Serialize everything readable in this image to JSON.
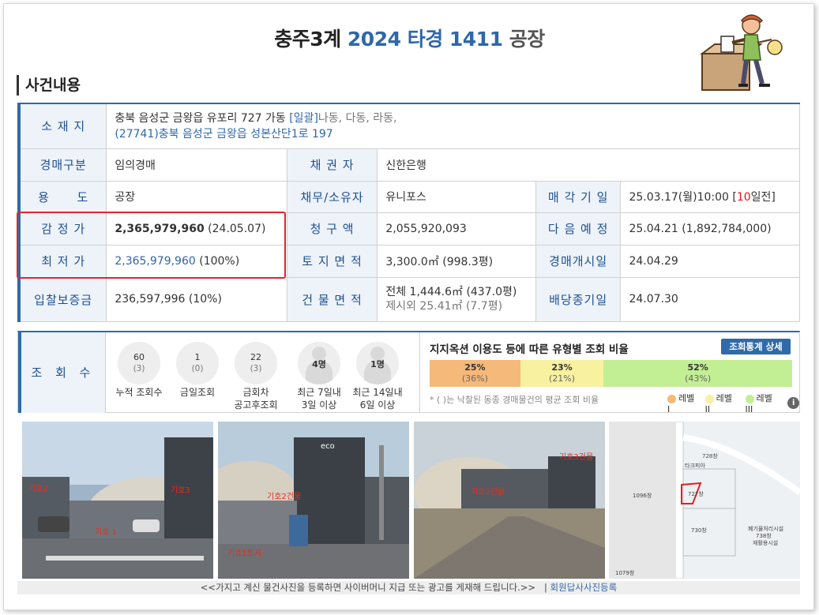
{
  "header": {
    "court": "충주3계",
    "case_no": "2024 타경 1411",
    "category": "공장"
  },
  "section_title": "사건내용",
  "info": {
    "location": {
      "label": "소 재 지",
      "line1": "충북 음성군 금왕읍 유포리 727 가동",
      "bulk": "[일괄]",
      "bulk_rest": "나동, 다동, 라동,",
      "line2": "(27741)충북 음성군  금왕읍 성본산단1로  197"
    },
    "auction_type": {
      "label": "경매구분",
      "value": "임의경매"
    },
    "creditor": {
      "label": "채 권 자",
      "value": "신한은행"
    },
    "usage": {
      "label": "용      도",
      "value": "공장"
    },
    "debtor_owner": {
      "label": "채무/소유자",
      "value": "유니포스"
    },
    "sale_date": {
      "label": "매 각 기 일",
      "value_pre": "25.03.17(월)10:00 [",
      "days": "10",
      "value_post": "일전]"
    },
    "appraisal": {
      "label": "감 정 가",
      "amount": "2,365,979,960",
      "note": "(24.05.07)"
    },
    "claim": {
      "label": "청 구 액",
      "value": "2,055,920,093"
    },
    "next_schedule": {
      "label": "다 음 예 정",
      "value": "25.04.21 (1,892,784,000)"
    },
    "minimum": {
      "label": "최 저 가",
      "amount": "2,365,979,960",
      "note": "(100%)"
    },
    "land_area": {
      "label": "토 지 면 적",
      "value": "3,300.0㎡ (998.3평)"
    },
    "auction_start": {
      "label": "경매개시일",
      "value": "24.04.29"
    },
    "deposit": {
      "label": "입찰보증금",
      "value": "236,597,996 (10%)"
    },
    "building_area": {
      "label": "건 물 면 적",
      "line1": "전체 1,444.6㎡ (437.0평)",
      "line2": "제시외 25.41㎡ (7.7평)"
    },
    "dividend_deadline": {
      "label": "배당종기일",
      "value": "24.07.30"
    }
  },
  "views": {
    "label": "조 회 수",
    "stats": [
      {
        "value": "60",
        "sub": "(3)",
        "caption1": "누적 조회수",
        "caption2": ""
      },
      {
        "value": "1",
        "sub": "(0)",
        "caption1": "금일조회",
        "caption2": ""
      },
      {
        "value": "22",
        "sub": "(3)",
        "caption1": "금회차",
        "caption2": "공고후조회"
      }
    ],
    "persons": [
      {
        "value": "4명",
        "caption1": "최근 7일내",
        "caption2": "3일 이상"
      },
      {
        "value": "1명",
        "caption1": "최근 14일내",
        "caption2": "6일 이상"
      }
    ],
    "ratio_title": "지지옥션 이용도 등에 따른 유형별 조회 비율",
    "ratio_button": "조회통계 상세",
    "ratio": [
      {
        "pct": "25%",
        "sub": "(36%)",
        "value": 25,
        "color": "#f5b97a"
      },
      {
        "pct": "23%",
        "sub": "(21%)",
        "value": 23,
        "color": "#f7f1a0"
      },
      {
        "pct": "52%",
        "sub": "(43%)",
        "value": 52,
        "color": "#c2ee94"
      }
    ],
    "note": "* ( )는 낙찰된 동종 경매물건의 평균 조회 비율",
    "legend": [
      {
        "label": "레벨 I",
        "color": "#f5b97a"
      },
      {
        "label": "레벨 II",
        "color": "#f7f1a0"
      },
      {
        "label": "레벨 III",
        "color": "#c2ee94"
      }
    ],
    "info_icon": "i"
  },
  "photos": {
    "labels": {
      "p1a": "기호2",
      "p1b": "기호3",
      "p1c": "기호 1",
      "p2a": "기호2건물",
      "p2b": "기호1토지",
      "p3a": "기호3건물",
      "p3b": "기호2건물",
      "p4_lot1": "728창",
      "p4_lot2": "727창",
      "p4_lot3": "1096창",
      "p4_lot4": "730창",
      "p4_lot5": "1079창",
      "p4_road": "타크피아",
      "p4_text1": "폐기물처리시설",
      "p4_text2": "738창",
      "p4_text3": "재활용시설"
    },
    "brand": "eco"
  },
  "footer": {
    "text": "<<가지고 계신 물건사진을 등록하면 사이버머니 지급 또는 광고를 게재해 드립니다.>>",
    "sep": "|",
    "link": "회원답사사진등록"
  }
}
